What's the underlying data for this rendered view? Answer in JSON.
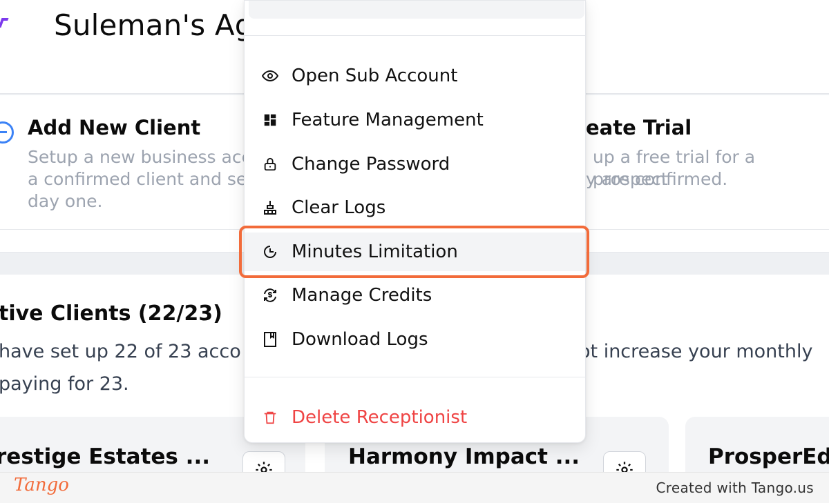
{
  "header": {
    "agency_title": "Suleman's Ag"
  },
  "actions": {
    "add_client": {
      "title": "Add New Client",
      "desc_line1": "Setup a new business acc",
      "desc_line2": "a confirmed client and se",
      "desc_line3": "day one."
    },
    "create_trial": {
      "title": "eate Trial",
      "desc_line1": "up a free trial for a prospect",
      "desc_line2": "y are confirmed."
    }
  },
  "clients": {
    "title": "tive Clients (22/23)",
    "desc_line1_left": " have set up 22 of 23 acco",
    "desc_line1_right": "ot increase your monthly",
    "desc_line2": "paying for 23.",
    "cards": [
      {
        "name": "restige Estates ..."
      },
      {
        "name": "Harmony Impact ..."
      },
      {
        "name": "ProsperEd"
      }
    ]
  },
  "menu": {
    "items": [
      {
        "label": "Open Sub Account",
        "icon": "eye-icon"
      },
      {
        "label": "Feature Management",
        "icon": "grid-icon"
      },
      {
        "label": "Change Password",
        "icon": "lock-icon"
      },
      {
        "label": "Clear Logs",
        "icon": "broom-icon"
      },
      {
        "label": "Minutes Limitation",
        "icon": "timer-icon"
      },
      {
        "label": "Manage Credits",
        "icon": "refresh-coin-icon"
      },
      {
        "label": "Download Logs",
        "icon": "bookmark-icon"
      }
    ],
    "delete_label": "Delete Receptionist",
    "danger_color": "#ef4444"
  },
  "highlight_color": "#f26b3a",
  "footer": {
    "brand": "Tango",
    "credit": "Created with Tango.us"
  }
}
